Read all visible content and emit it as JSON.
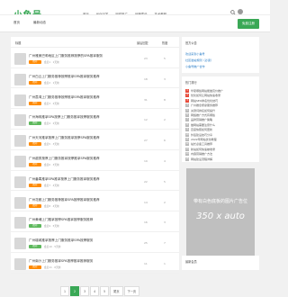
{
  "header": {
    "logo": "小鱼号",
    "nav": [
      "首页",
      "优化问答",
      "网络推广",
      "品牌建设",
      "技术教程"
    ],
    "login_label": "免费注册"
  },
  "breadcrumb": [
    "首页",
    "最新动态"
  ],
  "list_header": {
    "left": "标题",
    "col1": "最后回复",
    "col2": "热度"
  },
  "rows": [
    {
      "title": "广州雅美巴莉地区上门服务推荐按摩的SPA推拿服务",
      "tag": "推荐",
      "meta": "会员1 · 1天前",
      "n1": "23",
      "n2": "5"
    },
    {
      "title": "广州白云上门服务推荐按摩推拿SPA推拿服务推荐",
      "tag": "推荐",
      "meta": "会员2 · 1天前",
      "n1": "18",
      "n2": "3"
    },
    {
      "title": "广州荔湾上门服务推荐按摩推拿SPA推拿服务推荐",
      "tag": "推荐",
      "meta": "会员3 · 2天前",
      "n1": "31",
      "n2": "8"
    },
    {
      "title": "广州海珠推拿SPA按摩上门服务推拿按摩服务推荐",
      "tag": "推荐",
      "meta": "会员4 · 2天前",
      "n1": "12",
      "n2": "2"
    },
    {
      "title": "广州天河推拿按摩上门服务推拿按摩SPA服务推荐",
      "tag": "推荐",
      "meta": "会员5 · 3天前",
      "n1": "27",
      "n2": "6"
    },
    {
      "title": "广州越秀按摩上门服务推拿按摩推拿SPA服务推荐",
      "tag": "推荐",
      "meta": "会员6 · 3天前",
      "n1": "19",
      "n2": "4"
    },
    {
      "title": "广州番禺推拿SPA推拿按摩上门服务推拿服务推荐",
      "tag": "推荐",
      "meta": "会员7 · 4天前",
      "n1": "22",
      "n2": "5"
    },
    {
      "title": "广州花都上门服务推荐推拿SPA按摩推拿服务推荐",
      "tag": "推荐",
      "meta": "会员8 · 4天前",
      "n1": "14",
      "n2": "2"
    },
    {
      "title": "广州黄埔上门推拿按摩SPA推拿按摩服务推荐",
      "tag": "推荐",
      "meta": "会员9 · 5天前",
      "n1": "16",
      "n2": "3"
    },
    {
      "title": "广州增城推拿按摩上门服务推拿SPA按摩服务",
      "tag": "推荐",
      "meta": "会员10 · 5天前",
      "n1": "25",
      "n2": "7"
    },
    {
      "title": "广州南沙上门服务推拿SPA按摩推拿推荐服务",
      "tag": "推荐",
      "meta": "会员11 · 6天前",
      "n1": "11",
      "n2": "1"
    }
  ],
  "pagination": [
    "1",
    "2",
    "3",
    "4",
    "5",
    "尾页",
    "下一页"
  ],
  "sidebar": {
    "notice_title": "官方公告",
    "links": [
      "欢迎来到小鱼号",
      "社区发帖规则（必读）",
      "小鱼号推广合作"
    ],
    "rank_title": "热门排行",
    "rank_items": [
      "华夏哪些网站能做竞价推广",
      "优化如何让网站快速收录",
      "网站SEO排名优化技巧",
      "广州推拿按摩服务推荐",
      "关键词排名如何提升",
      "网络推广方式有哪些",
      "品牌营销推广策略",
      "做网站需要注意什么",
      "百度快照如何更新",
      "外链建设技巧分享",
      "2022年网站优化教程",
      "站长必备工具推荐",
      "新站如何快速被收录",
      "内容营销推广方法",
      "网站建设流程详解"
    ],
    "ad_line1": "带有白色底板的图片广告位",
    "ad_line2": "350 x auto",
    "users_title": "最新会员"
  }
}
